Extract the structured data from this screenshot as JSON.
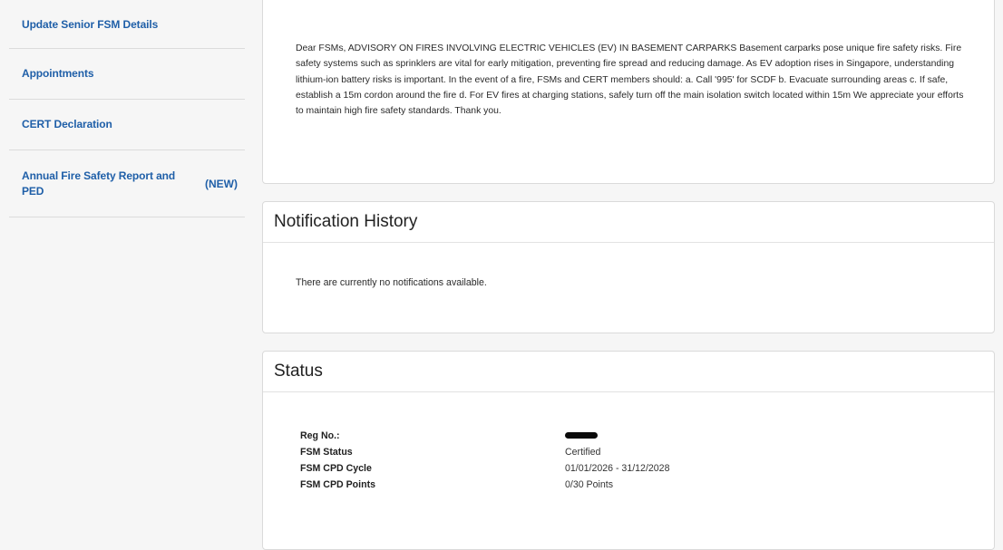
{
  "sidebar": {
    "items": [
      {
        "label": "Update Senior FSM Details",
        "tag": ""
      },
      {
        "label": "Appointments",
        "tag": ""
      },
      {
        "label": "CERT Declaration",
        "tag": ""
      },
      {
        "label": "Annual Fire Safety Report and PED",
        "tag": "(NEW)"
      }
    ]
  },
  "advisory": {
    "text": "Dear FSMs, ADVISORY ON FIRES INVOLVING ELECTRIC VEHICLES (EV) IN BASEMENT CARPARKS Basement carparks pose unique fire safety risks. Fire safety systems such as sprinklers are vital for early mitigation, preventing fire spread and reducing damage. As EV adoption rises in Singapore, understanding lithium-ion battery risks is important. In the event of a fire, FSMs and CERT members should: a. Call '995' for SCDF b. Evacuate surrounding areas c. If safe, establish a 15m cordon around the fire d. For EV fires at charging stations, safely turn off the main isolation switch located within 15m We appreciate your efforts to maintain high fire safety standards. Thank you."
  },
  "notification_history": {
    "title": "Notification History",
    "empty_message": "There are currently no notifications available."
  },
  "status": {
    "title": "Status",
    "rows": [
      {
        "label": "Reg No.:",
        "value": ""
      },
      {
        "label": "FSM Status",
        "value": "Certified"
      },
      {
        "label": "FSM CPD Cycle",
        "value": "01/01/2026 - 31/12/2028"
      },
      {
        "label": "FSM CPD Points",
        "value": "0/30 Points"
      }
    ]
  },
  "colors": {
    "link": "#1f5fa8",
    "background": "#f6f6f6",
    "card": "#ffffff"
  }
}
